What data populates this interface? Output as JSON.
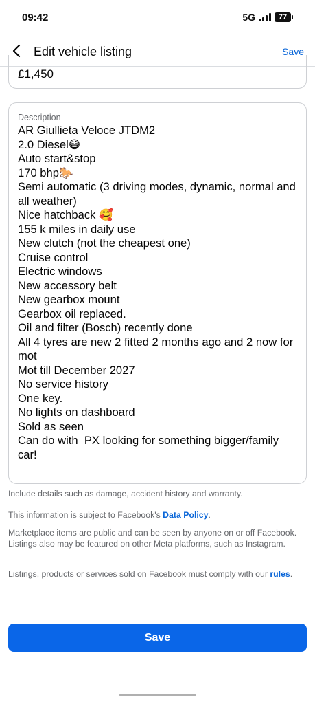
{
  "status_bar": {
    "time": "09:42",
    "network": "5G",
    "battery": "77"
  },
  "header": {
    "back_icon": "chevron-left-icon",
    "title": "Edit vehicle listing",
    "save_label": "Save"
  },
  "price": {
    "value": "£1,450"
  },
  "description": {
    "label": "Description",
    "text": "AR Giullieta Veloce JTDM2\n2.0 Diesel😷\nAuto start&stop\n170 bhp🐎\nSemi automatic (3 driving modes, dynamic, normal and all weather)\nNice hatchback 🥰\n155 k miles in daily use\nNew clutch (not the cheapest one)\nCruise control\nElectric windows\nNew accessory belt\nNew gearbox mount\nGearbox oil replaced.\nOil and filter (Bosch) recently done\nAll 4 tyres are new 2 fitted 2 months ago and 2 now for mot\nMot till December 2027\nNo service history\nOne key.\nNo lights on dashboard\nSold as seen\nCan do with  PX looking for something bigger/family car!"
  },
  "helper_text": "Include details such as damage, accident history and warranty.",
  "data_policy": {
    "prefix": "This information is subject to Facebook's ",
    "link": "Data Policy",
    "suffix": "."
  },
  "marketplace_notice": "Marketplace items are public and can be seen by anyone on or off Facebook. Listings also may be featured on other Meta platforms, such as Instagram.",
  "rules_notice": {
    "prefix": "Listings, products or services sold on Facebook must comply with our ",
    "link": "rules",
    "suffix": "."
  },
  "footer": {
    "save_label": "Save"
  },
  "colors": {
    "accent": "#0a66e8",
    "link": "#0a66d8",
    "border": "#ced0d4",
    "secondary_text": "#65676b"
  }
}
